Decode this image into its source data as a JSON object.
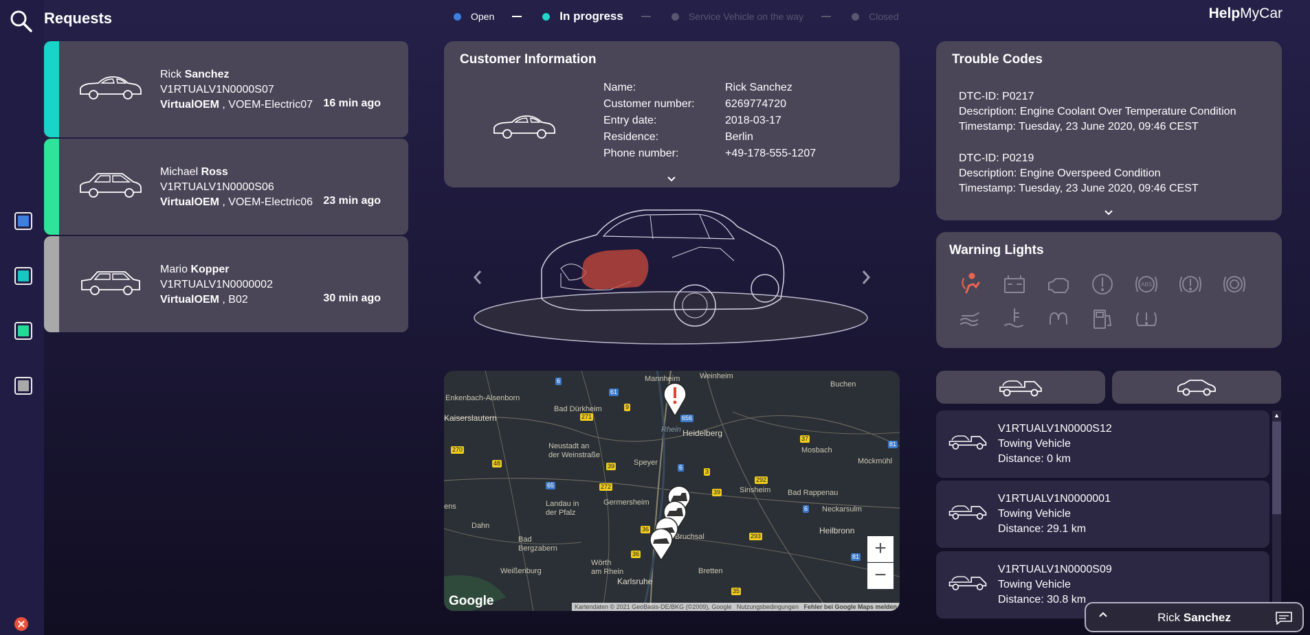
{
  "sidebar": {
    "title": "Requests",
    "filters": [
      {
        "name": "open",
        "color": "#3b7fe0"
      },
      {
        "name": "in-progress",
        "color": "#19c6c1"
      },
      {
        "name": "service-on-the-way",
        "color": "#25d996"
      },
      {
        "name": "closed",
        "color": "#a9a9a9"
      }
    ]
  },
  "status_steps": [
    {
      "label": "Open",
      "dot_color": "#3b7fe0",
      "text_color": "#ffffff",
      "bold": false
    },
    {
      "label": "In progress",
      "dot_color": "#1fd6c9",
      "text_color": "#ffffff",
      "bold": true
    },
    {
      "label": "Service Vehicle on the way",
      "dot_color": "#5a5670",
      "text_color": "#5a5670",
      "bold": false
    },
    {
      "label": "Closed",
      "dot_color": "#5a5670",
      "text_color": "#5a5670",
      "bold": false
    }
  ],
  "brand": {
    "bold": "Help",
    "rest": "MyCar"
  },
  "requests": [
    {
      "first": "Rick",
      "last": "Sanchez",
      "vin": "V1RTUALV1N0000S07",
      "oem": "VirtualOEM",
      "model": ", VOEM-Electric07",
      "ago": "16 min ago",
      "stripe": "#19d4c8",
      "icon": "sedan-icon"
    },
    {
      "first": "Michael",
      "last": "Ross",
      "vin": "V1RTUALV1N0000S06",
      "oem": "VirtualOEM",
      "model": ", VOEM-Electric06",
      "ago": "23 min ago",
      "stripe": "#2ee39a",
      "icon": "hatchback-icon"
    },
    {
      "first": "Mario",
      "last": "Kopper",
      "vin": "V1RTUALV1N0000002",
      "oem": "VirtualOEM",
      "model": ", B02",
      "ago": "30 min ago",
      "stripe": "#a9a9a9",
      "icon": "suv-icon"
    }
  ],
  "customer": {
    "title": "Customer Information",
    "labels": {
      "name": "Name:",
      "number": "Customer number:",
      "entry": "Entry date:",
      "residence": "Residence:",
      "phone": "Phone number:"
    },
    "values": {
      "name": "Rick Sanchez",
      "number": "6269774720",
      "entry": "2018-03-17",
      "residence": "Berlin",
      "phone": "+49-178-555-1207"
    }
  },
  "trouble": {
    "title": "Trouble Codes",
    "codes": [
      {
        "id": "DTC-ID: P0217",
        "desc": "Description: Engine Coolant Over Temperature Condition",
        "ts": "Timestamp: Tuesday, 23 June 2020, 09:46 CEST"
      },
      {
        "id": "DTC-ID: P0219",
        "desc": "Description: Engine Overspeed Condition",
        "ts": "Timestamp: Tuesday, 23 June 2020, 09:46 CEST"
      }
    ]
  },
  "warning": {
    "title": "Warning Lights",
    "lights": [
      {
        "name": "airbag-warning-icon",
        "active": true
      },
      {
        "name": "battery-warning-icon",
        "active": false
      },
      {
        "name": "engine-check-icon",
        "active": false
      },
      {
        "name": "general-warning-icon",
        "active": false
      },
      {
        "name": "abs-warning-icon",
        "active": false
      },
      {
        "name": "brake-warning-icon",
        "active": false
      },
      {
        "name": "brake-pad-warning-icon",
        "active": false
      },
      {
        "name": "oil-level-icon",
        "active": false
      },
      {
        "name": "coolant-temperature-icon",
        "active": false
      },
      {
        "name": "glow-plug-icon",
        "active": false
      },
      {
        "name": "fuel-level-icon",
        "active": false
      },
      {
        "name": "tire-pressure-icon",
        "active": false
      }
    ],
    "active_color": "#e8664f",
    "inactive_color": "#8a869a"
  },
  "map": {
    "places": [
      "Weinheim",
      "Enkenbach-Alsenborn",
      "Bad Dürkheim",
      "Mannheim",
      "Buchen",
      "Kaiserslautern",
      "Heidelberg",
      "Neustadt an der Weinstraße",
      "Speyer",
      "Mosbach",
      "Möckmühl",
      "Sinsheim",
      "Bad Rappenau",
      "Landau in der Pfalz",
      "Germersheim",
      "Neckarsulm",
      "ens",
      "Dahn",
      "Heilbronn",
      "Bad Bergzabern",
      "Weißenburg",
      "Wörth am Rhein",
      "Karlsruhe",
      "Bretten",
      "Bruchsal"
    ],
    "roads": [
      "6",
      "61",
      "656",
      "271",
      "9",
      "37",
      "81",
      "270",
      "48",
      "39",
      "6",
      "3",
      "292",
      "65",
      "272",
      "39",
      "6",
      "36",
      "293",
      "35",
      "36",
      "81",
      "Rhein"
    ],
    "attribution": "Kartendaten © 2021 GeoBasis-DE/BKG (©2009), Google",
    "terms": "Nutzungsbedingungen",
    "report": "Fehler bei Google Maps melden",
    "logo": "Google",
    "zoom_in": "+",
    "zoom_out": "−"
  },
  "vehicles": [
    {
      "id": "V1RTUALV1N0000S12",
      "type": "Towing Vehicle",
      "distance": "Distance: 0 km"
    },
    {
      "id": "V1RTUALV1N0000001",
      "type": "Towing Vehicle",
      "distance": "Distance: 29.1 km"
    },
    {
      "id": "V1RTUALV1N0000S09",
      "type": "Towing Vehicle",
      "distance": "Distance: 30.8 km"
    }
  ],
  "user": {
    "first": "Rick",
    "last": "Sanchez"
  }
}
